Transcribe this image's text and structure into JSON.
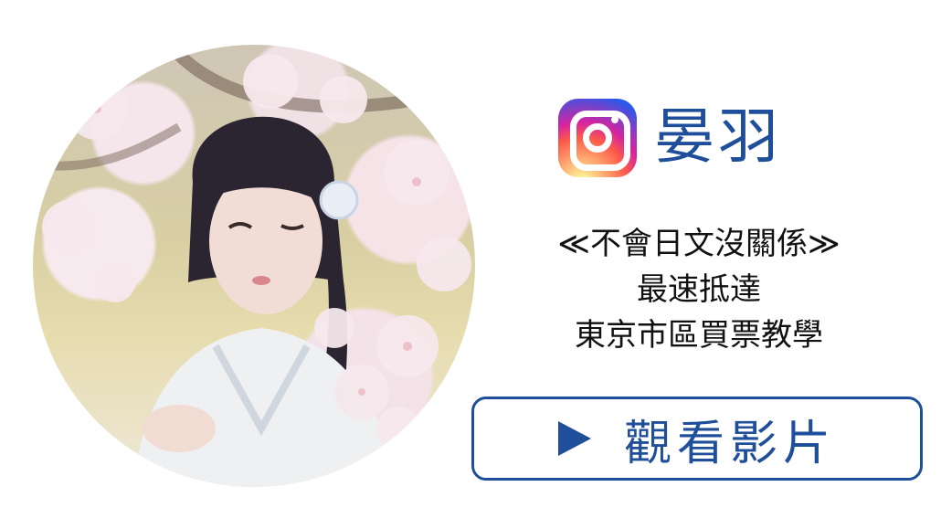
{
  "profile": {
    "platform_icon": "instagram-icon",
    "account_name": "晏羽"
  },
  "description": {
    "line1": "≪不會日文沒關係≫",
    "line2": "最速抵達",
    "line3": "東京市區買票教學"
  },
  "watch_button": {
    "icon": "play-icon",
    "label": "觀看影片"
  },
  "colors": {
    "accent": "#1f4e9a",
    "text": "#111111",
    "background": "#ffffff"
  }
}
